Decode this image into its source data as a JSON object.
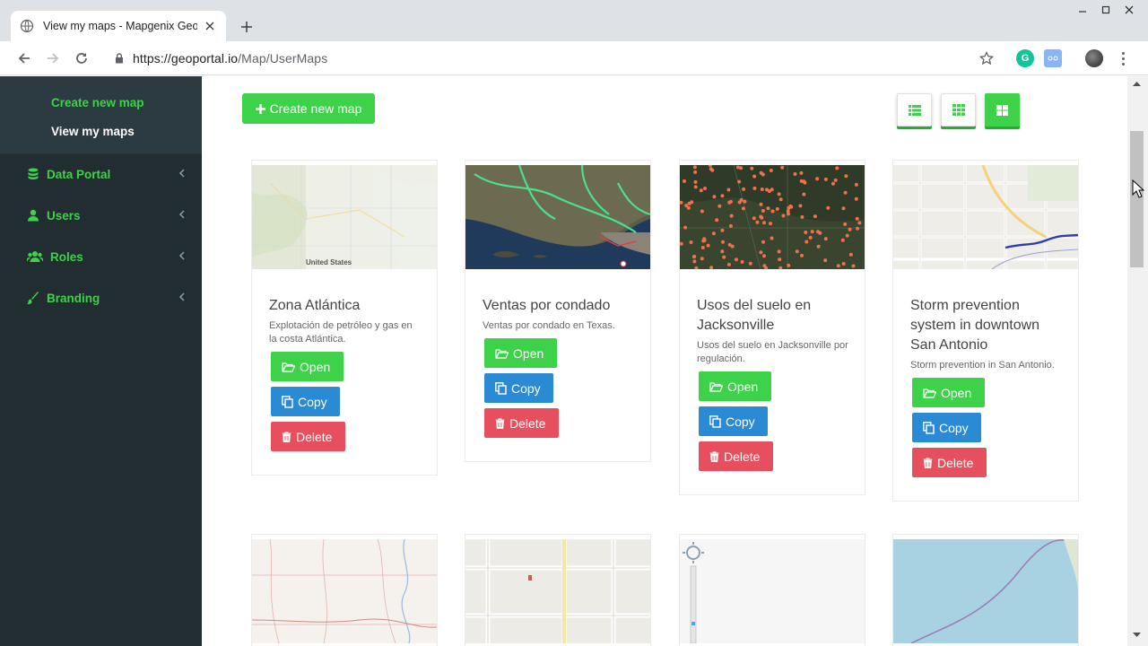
{
  "browser": {
    "tab_title": "View my maps - Mapgenix GeoP",
    "url_host": "https://geoportal.io",
    "url_path": "/Map/UserMaps"
  },
  "sidebar": {
    "subitems": [
      {
        "label": "Create new map"
      },
      {
        "label": "View my maps"
      }
    ],
    "items": [
      {
        "label": "Data Portal",
        "icon": "database-icon"
      },
      {
        "label": "Users",
        "icon": "user-icon"
      },
      {
        "label": "Roles",
        "icon": "users-icon"
      },
      {
        "label": "Branding",
        "icon": "brush-icon"
      }
    ]
  },
  "toolbar": {
    "create_label": "Create new map",
    "view_modes": [
      "list-view",
      "grid-small-view",
      "grid-large-view"
    ],
    "active_view": "grid-large-view"
  },
  "buttons": {
    "open": "Open",
    "copy": "Copy",
    "delete": "Delete"
  },
  "maps": [
    {
      "title": "Zona Atlántica",
      "description": "Explotación de petróleo y gas en la costa Atlántica."
    },
    {
      "title": "Ventas por condado",
      "description": "Ventas por condado en Texas."
    },
    {
      "title": "Usos del suelo en Jacksonville",
      "description": "Usos del suelo en Jacksonville por regulación."
    },
    {
      "title": "Storm prevention system in downtown San Antonio",
      "description": "Storm prevention in San Antonio."
    }
  ],
  "thumb_labels": {
    "map1_country": "United States"
  },
  "colors": {
    "accent_green": "#3ed14a",
    "copy_blue": "#2a8bd4",
    "delete_red": "#e6505e",
    "sidebar_bg": "#222d32"
  }
}
